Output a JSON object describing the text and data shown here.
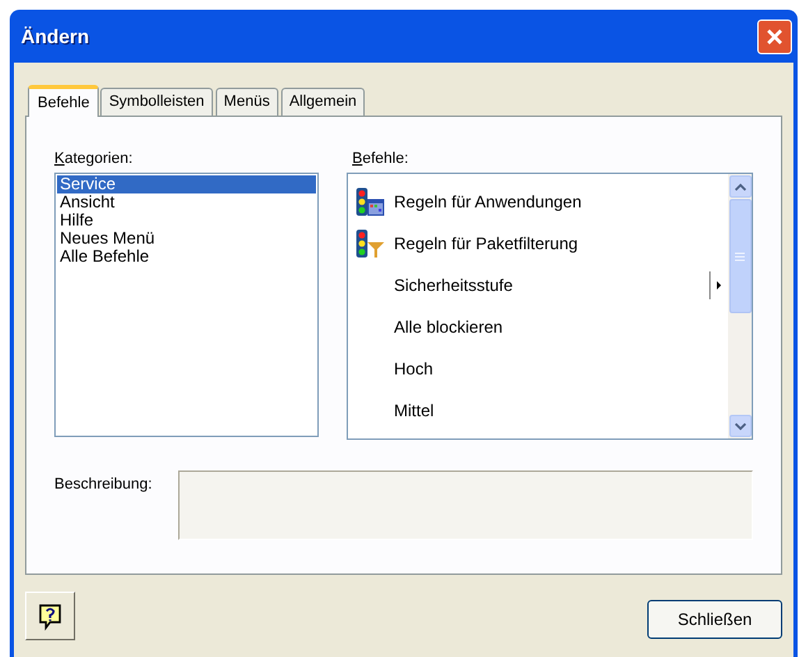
{
  "window": {
    "title": "Ändern"
  },
  "tabs": [
    {
      "label": "Befehle",
      "selected": true
    },
    {
      "label": "Symbolleisten",
      "selected": false
    },
    {
      "label": "Menüs",
      "selected": false
    },
    {
      "label": "Allgemein",
      "selected": false
    }
  ],
  "categories": {
    "label": "Kategorien:",
    "items": [
      {
        "label": "Service",
        "selected": true
      },
      {
        "label": "Ansicht",
        "selected": false
      },
      {
        "label": "Hilfe",
        "selected": false
      },
      {
        "label": "Neues Menü",
        "selected": false
      },
      {
        "label": "Alle Befehle",
        "selected": false
      }
    ]
  },
  "commands": {
    "label": "Befehle:",
    "items": [
      {
        "label": "Regeln für Anwendungen",
        "kind": "app"
      },
      {
        "label": "Regeln für Paketfilterung",
        "kind": "filter"
      },
      {
        "label": "Sicherheitsstufe",
        "kind": "submenu"
      },
      {
        "label": "Alle blockieren",
        "kind": "plain"
      },
      {
        "label": "Hoch",
        "kind": "plain"
      },
      {
        "label": "Mittel",
        "kind": "plain"
      }
    ]
  },
  "description": {
    "label": "Beschreibung:"
  },
  "buttons": {
    "close": "Schließen"
  }
}
